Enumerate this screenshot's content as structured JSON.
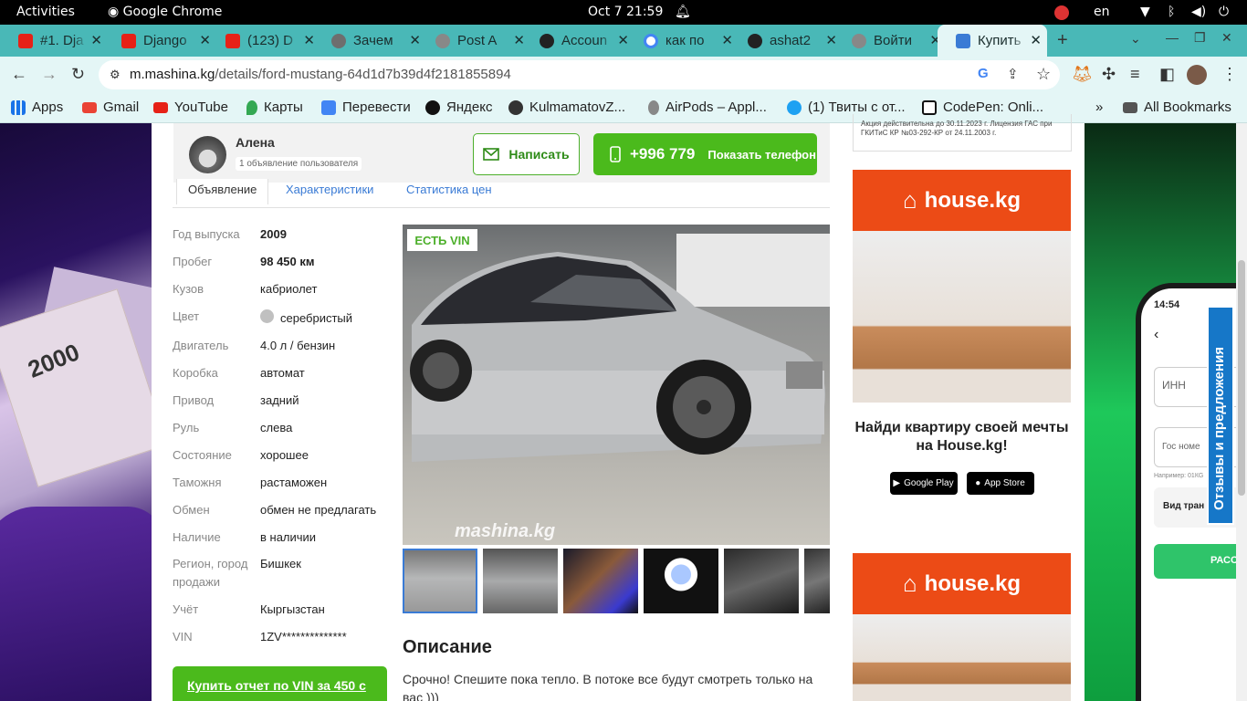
{
  "system": {
    "activities": "Activities",
    "app": "Google Chrome",
    "datetime": "Oct 7  21:59",
    "lang": "en"
  },
  "tabs": [
    {
      "label": "#1. Dja",
      "color": "#e62117"
    },
    {
      "label": "Django",
      "color": "#e62117"
    },
    {
      "label": "(123) D",
      "color": "#e62117"
    },
    {
      "label": "Зачем",
      "color": "#6e6e6e"
    },
    {
      "label": "Post A",
      "color": "#888888"
    },
    {
      "label": "Accoun",
      "color": "#222222"
    },
    {
      "label": "как по",
      "color": "#4285f4"
    },
    {
      "label": "ashat2",
      "color": "#222222"
    },
    {
      "label": "Войти",
      "color": "#888888"
    },
    {
      "label": "Купить",
      "color": "#3a7bd5"
    }
  ],
  "url": {
    "host": "m.mashina.kg",
    "path": "/details/ford-mustang-64d1d7b39d4f2181855894"
  },
  "bookmarks": [
    {
      "label": "Apps",
      "icon": "apps-grid-icon"
    },
    {
      "label": "Gmail",
      "icon": "gmail-icon"
    },
    {
      "label": "YouTube",
      "icon": "youtube-icon"
    },
    {
      "label": "Карты",
      "icon": "maps-icon"
    },
    {
      "label": "Перевести",
      "icon": "translate-icon"
    },
    {
      "label": "Яндекс",
      "icon": "yandex-icon"
    },
    {
      "label": "KulmamatovZ...",
      "icon": "github-icon"
    },
    {
      "label": "AirPods – Appl...",
      "icon": "apple-icon"
    },
    {
      "label": "(1) Твиты с от...",
      "icon": "twitter-icon"
    },
    {
      "label": "CodePen: Onli...",
      "icon": "codepen-icon"
    }
  ],
  "all_bookmarks": "All Bookmarks",
  "seller": {
    "name": "Алена",
    "count": "1 объявление пользователя"
  },
  "buttons": {
    "write": "Написать",
    "phone": "+996 779",
    "show_phone": "Показать телефон"
  },
  "page_tabs": [
    "Объявление",
    "Характеристики",
    "Статистика цен"
  ],
  "specs": [
    {
      "k": "Год выпуска",
      "v": "2009",
      "bold": true
    },
    {
      "k": "Пробег",
      "v": "98 450 км",
      "bold": true
    },
    {
      "k": "Кузов",
      "v": "кабриолет"
    },
    {
      "k": "Цвет",
      "v": "серебристый",
      "swatch": "#c0c0c0"
    },
    {
      "k": "Двигатель",
      "v": "4.0 л / бензин"
    },
    {
      "k": "Коробка",
      "v": "автомат"
    },
    {
      "k": "Привод",
      "v": "задний"
    },
    {
      "k": "Руль",
      "v": "слева"
    },
    {
      "k": "Состояние",
      "v": "хорошее"
    },
    {
      "k": "Таможня",
      "v": "растаможен"
    },
    {
      "k": "Обмен",
      "v": "обмен не предлагать"
    },
    {
      "k": "Наличие",
      "v": "в наличии"
    },
    {
      "k": "Регион, город продажи",
      "v": "Бишкек"
    },
    {
      "k": "Учёт",
      "v": "Кыргызстан"
    },
    {
      "k": "VIN",
      "v": "1ZV**************"
    }
  ],
  "vin_badge": "ЕСТЬ VIN",
  "watermark": "mashina.kg",
  "description_title": "Описание",
  "description": "Срочно! Спешите пока тепло. В потоке все будут смотреть только на вас )))",
  "buy_vin": "Купить отчет по VIN за 450 с",
  "license": "Акция действительна до 30.11.2023 г. Лицензия ГАС при ГКИТиС КР №03-292-КР от 24.11.2003 г.",
  "ad": {
    "brand": "house.kg",
    "text": "Найди квартиру своей мечты на House.kg!",
    "google": "Google Play",
    "apple": "App Store"
  },
  "phone_ui": {
    "time": "14:54",
    "inn": "ИНН",
    "gos": "Гос номе",
    "hint": "Например: 01КG",
    "vid": "Вид тран",
    "btn": "РАСС"
  },
  "feedback": "Отзывы и предложения",
  "colors": {
    "brand_green": "#4bba1c",
    "link_blue": "#3a7bd5",
    "house_orange": "#ec4b16",
    "tab_bar": "#49b8b7"
  }
}
